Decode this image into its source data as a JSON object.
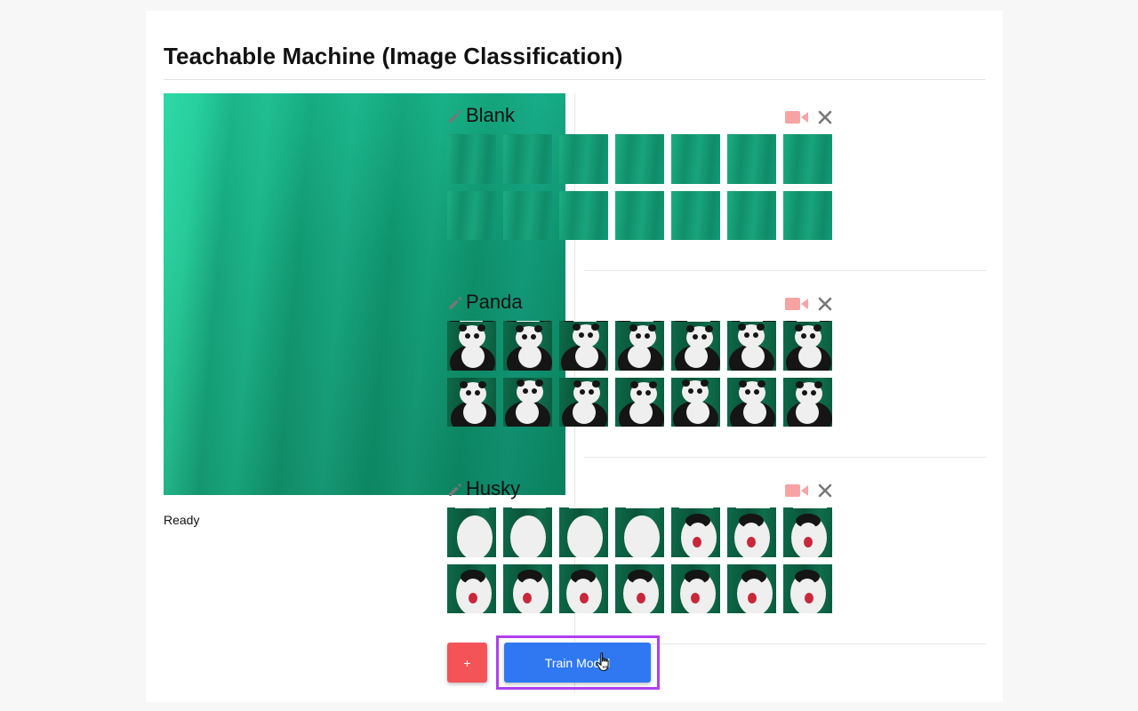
{
  "app": {
    "title": "Teachable Machine (Image Classification)",
    "status": "Ready"
  },
  "classes": [
    {
      "name": "Blank",
      "thumb_kind": "blank"
    },
    {
      "name": "Panda",
      "thumb_kind": "panda"
    },
    {
      "name": "Husky",
      "thumb_kind": "husky"
    }
  ],
  "actions": {
    "add_label": "+",
    "train_label": "Train Model"
  },
  "icons": {
    "edit": "pencil-icon",
    "record": "video-camera-icon",
    "remove": "close-icon",
    "cursor": "hand-pointer-icon"
  },
  "colors": {
    "train_button": "#2f78f2",
    "add_button": "#f35458",
    "highlight_outline": "#b03ff0",
    "record_icon": "#f7a3a3"
  }
}
